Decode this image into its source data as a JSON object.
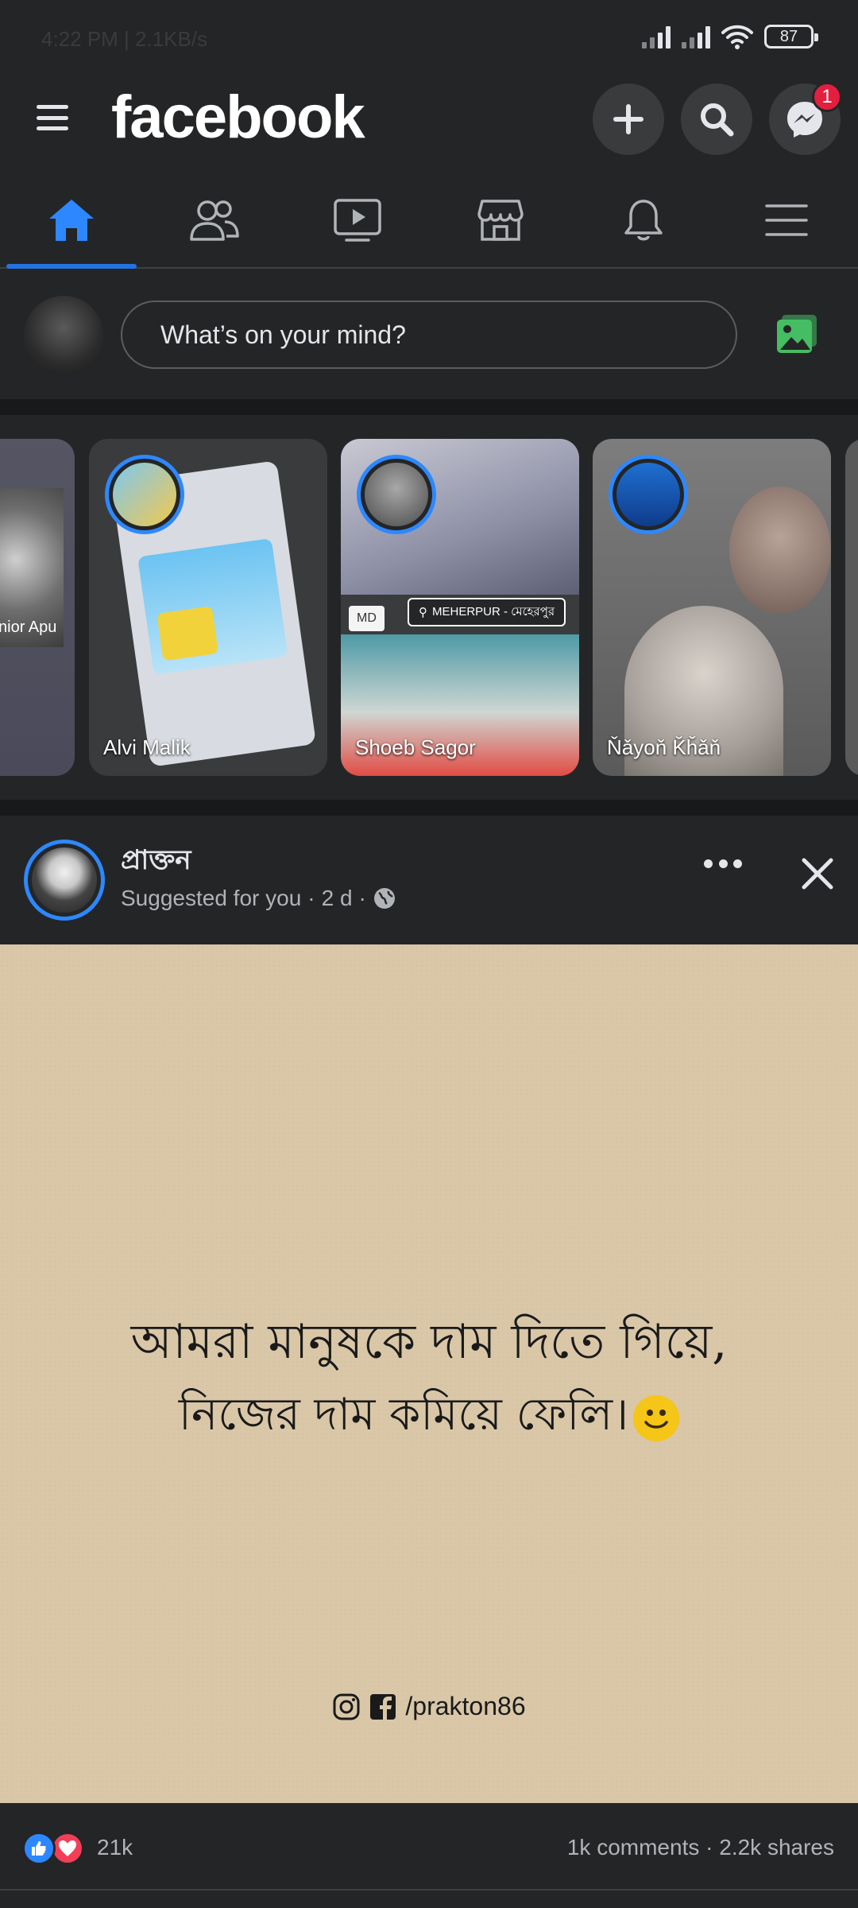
{
  "status_bar": {
    "time": "4:22 PM | 2.1KB/s",
    "battery": "87"
  },
  "header": {
    "logo": "facebook",
    "messenger_badge": "1"
  },
  "nav_tabs": [
    {
      "name": "home",
      "active": true
    },
    {
      "name": "friends"
    },
    {
      "name": "watch"
    },
    {
      "name": "marketplace"
    },
    {
      "name": "notifications"
    },
    {
      "name": "menu"
    }
  ],
  "composer": {
    "placeholder": "What’s on your mind?"
  },
  "stories": [
    {
      "name": "nior Apu"
    },
    {
      "name": "Alvi Malik"
    },
    {
      "name": "Shoeb Sagor",
      "tag_md": "MD",
      "location": "MEHERPUR - মেহেরপুর"
    },
    {
      "name": "Ňǎyoň Ǩȟǎň"
    }
  ],
  "post": {
    "author": "প্রাক্তন",
    "suggested": "Suggested for you",
    "time": "2 d",
    "quote_line_1": "আমরা মানুষকে দাম দিতে গিয়ে,",
    "quote_line_2": "নিজের দাম কমিয়ে ফেলি।",
    "handle": "/prakton86",
    "reaction_count": "21k",
    "comments": "1k comments",
    "shares": "2.2k shares"
  },
  "colors": {
    "background": "#242526",
    "accent": "#2374e1",
    "post_bg": "#d9c7a7"
  }
}
